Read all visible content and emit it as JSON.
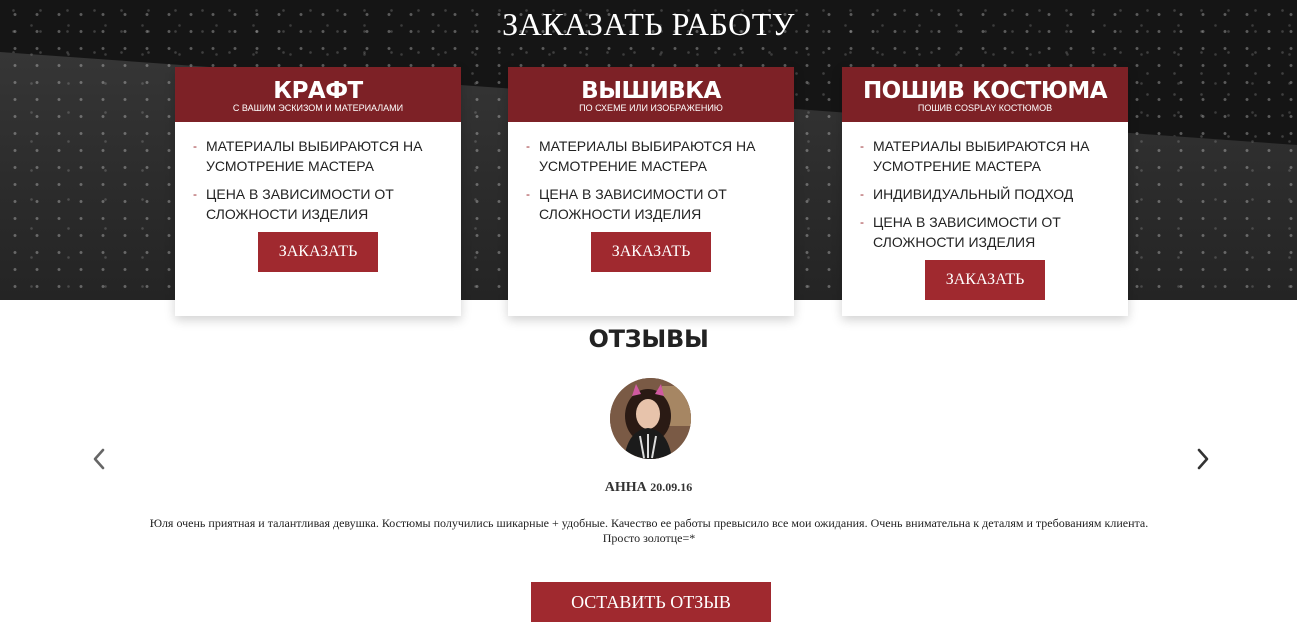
{
  "hero": {
    "title": "ЗАКАЗАТЬ РАБОТУ"
  },
  "cards": [
    {
      "title": "КРАФТ",
      "subtitle": "С ВАШИМ ЭСКИЗОМ И МАТЕРИАЛАМИ",
      "items": [
        "МАТЕРИАЛЫ ВЫБИРАЮТСЯ НА УСМОТРЕНИЕ МАСТЕРА",
        "ЦЕНА В ЗАВИСИМОСТИ ОТ СЛОЖНОСТИ ИЗДЕЛИЯ"
      ],
      "button": "ЗАКАЗАТЬ"
    },
    {
      "title": "ВЫШИВКА",
      "subtitle": "ПО СХЕМЕ ИЛИ ИЗОБРАЖЕНИЮ",
      "items": [
        "МАТЕРИАЛЫ ВЫБИРАЮТСЯ НА УСМОТРЕНИЕ МАСТЕРА",
        "ЦЕНА В ЗАВИСИМОСТИ ОТ СЛОЖНОСТИ ИЗДЕЛИЯ"
      ],
      "button": "ЗАКАЗАТЬ"
    },
    {
      "title": "ПОШИВ КОСТЮМА",
      "subtitle": "ПОШИВ COSPLAY КОСТЮМОВ",
      "items": [
        "МАТЕРИАЛЫ ВЫБИРАЮТСЯ НА УСМОТРЕНИЕ МАСТЕРА",
        "ИНДИВИДУАЛЬНЫЙ ПОДХОД",
        "ЦЕНА В ЗАВИСИМОСТИ ОТ СЛОЖНОСТИ ИЗДЕЛИЯ"
      ],
      "button": "ЗАКАЗАТЬ"
    }
  ],
  "reviews": {
    "title": "ОТЗЫВЫ",
    "prev_icon": "chevron-left-icon",
    "next_icon": "chevron-right-icon",
    "author": "АННА",
    "date": "20.09.16",
    "text": "Юля очень приятная и талантливая девушка. Костюмы получились шикарные + удобные. Качество ее работы превысило все мои ожидания. Очень внимательна к деталям и требованиям клиента. Просто золотце=*",
    "leave_button": "ОСТАВИТЬ ОТЗЫВ"
  },
  "colors": {
    "accent": "#a0292f",
    "card_header": "#7d2126"
  }
}
